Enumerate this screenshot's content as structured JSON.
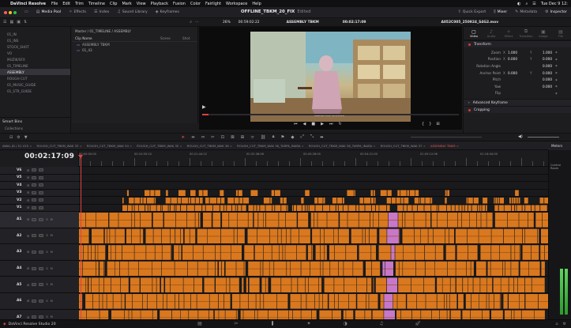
{
  "menubar": {
    "app": "DaVinci Resolve",
    "items": [
      "File",
      "Edit",
      "Trim",
      "Timeline",
      "Clip",
      "Mark",
      "View",
      "Playback",
      "Fusion",
      "Color",
      "Fairlight",
      "Workspace",
      "Help"
    ],
    "clock": "Tue Dec 9 12:"
  },
  "toolbar": {
    "media_pool": "Media Pool",
    "effects": "Effects",
    "index": "Index",
    "sound_library": "Sound Library",
    "keyframes": "Keyframes",
    "project_title": "OFFLINE_TBKM_20_FIX",
    "project_state": "Edited",
    "quick_export": "Quick Export",
    "mixer": "Mixer",
    "metadata": "Metadata",
    "inspector": "Inspector"
  },
  "subbar": {
    "zoom": "26%",
    "source_tc": "00:59:02:22",
    "timeline_name": "ASSEMBLY TBKM",
    "record_tc": "00:02:17:09",
    "clip_name": "A052C005_250924_S4G2.mov"
  },
  "bins": [
    "01_IN",
    "01_INS",
    "STOCK_SHOT",
    "VO",
    "MUZIK/SFX",
    "01_TIMELINE",
    "ASSEMBLY",
    "ROUGH CUT",
    "01_MUSIC_GUIDE",
    "01_STR_GUIDE"
  ],
  "bins_selected": 6,
  "smart_bins": {
    "title": "Smart Bins",
    "item": "Collections"
  },
  "pool": {
    "breadcrumb": "Master / 01_TIMELINE / ASSEMBLY",
    "col_name": "Clip Name",
    "col_sort": "Scene",
    "col_shot": "Shot",
    "rows": [
      "ASSEMBLY TBKM",
      "01_43"
    ]
  },
  "viewer": {
    "caption": "Subtitle text reference"
  },
  "inspector": {
    "tabs": [
      "Video",
      "Audio",
      "Effect",
      "Transition",
      "Image",
      "File"
    ],
    "section_transform": "Transform",
    "rows": [
      {
        "label": "Zoom",
        "x": "1.000",
        "y": "1.000"
      },
      {
        "label": "Position",
        "x": "0.000",
        "y": "0.000"
      },
      {
        "label": "Rotation Angle",
        "x": "",
        "y": "0.000"
      },
      {
        "label": "Anchor Point",
        "x": "0.000",
        "y": "0.000"
      },
      {
        "label": "Pitch",
        "x": "",
        "y": "0.000"
      },
      {
        "label": "Yaw",
        "x": "",
        "y": "0.000"
      },
      {
        "label": "Flip",
        "x": "",
        "y": ""
      }
    ],
    "section_keyframe": "Advanced Keyframe",
    "section_crop": "Cropping"
  },
  "timeline_tabs": [
    "AWAL JD / S1 V25",
    "ROUGH_CUT_TBKM_WAK 33",
    "ROUGH_CUT_TBKM_WAK 34",
    "ROUGH_CUT_TBKM_WAK 35",
    "ROUGH_CUT_TBKM_WAK 36",
    "ROUGH_CUT_TBKM_WAK 36_TARPA_INARA",
    "ROUGH_CUT_TBKM_WAK 36_TARPA_INARA",
    "ROUGH_CUT_TBKM_WAK 37",
    "ASSEMBLY TBKM"
  ],
  "timeline_tabs_active": 8,
  "timeline": {
    "timecode": "00:02:17:09",
    "ruler": [
      "00:00:00:00",
      "00:10:55:10",
      "00:21:44:22",
      "00:32:38:06",
      "00:43:28:00",
      "00:54:21:00",
      "01:05:12:06",
      "01:16:04:00"
    ],
    "video_tracks": [
      "V6",
      "V5",
      "V4",
      "V3",
      "V2",
      "V1"
    ],
    "audio_tracks": [
      "A1",
      "A2",
      "A3",
      "A4",
      "A5",
      "A6",
      "A7",
      "A8"
    ]
  },
  "meters_label": "Meters",
  "meters_sub": "Control Room",
  "dock": {
    "brand": "DaVinci Resolve Studio 20",
    "active_page": 2
  },
  "colors": {
    "clip_orange": "#d9781f",
    "clip_pink": "#c878c8",
    "playhead_red": "#e0403f",
    "accent": "#d63a3a"
  }
}
